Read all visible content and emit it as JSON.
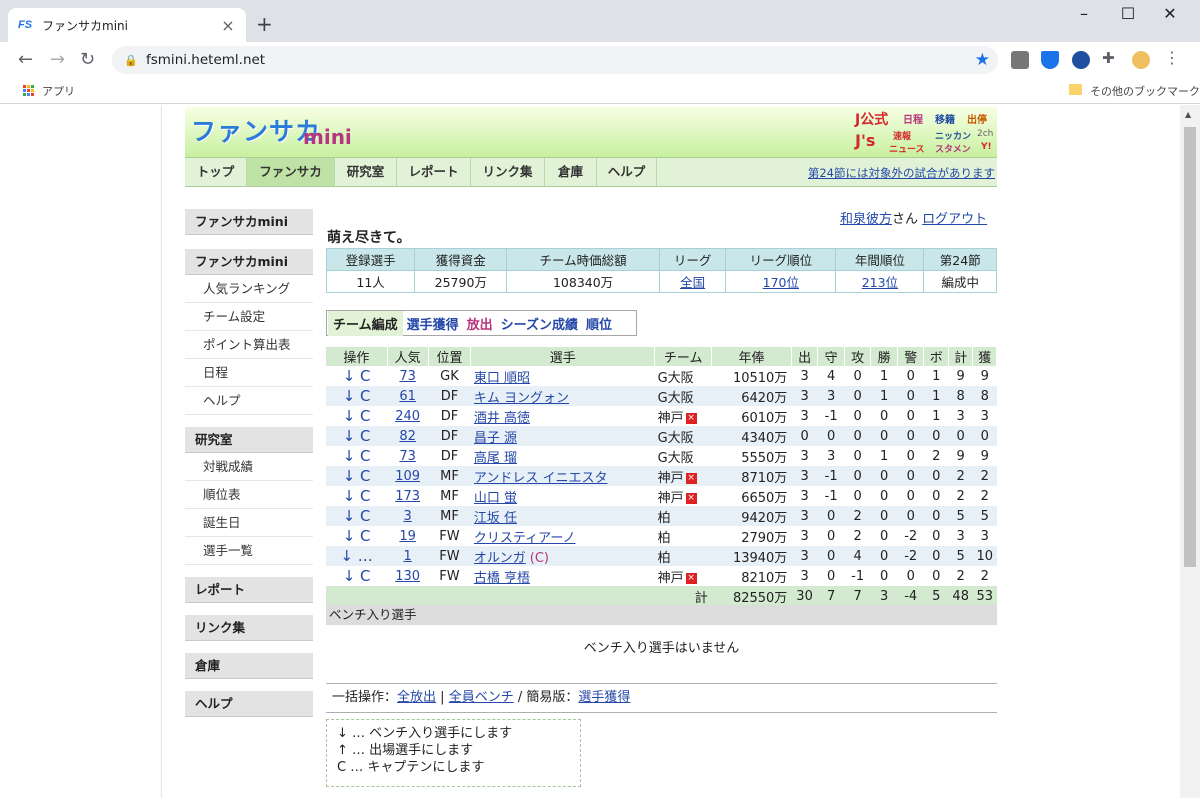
{
  "browser": {
    "tab_favicon": "FS",
    "tab_title": "ファンサカmini",
    "url": "fsmini.heteml.net",
    "bookmarks_apps": "アプリ",
    "bookmarks_other": "その他のブックマーク"
  },
  "header": {
    "logo": "ファンサカ",
    "logo_sub": "mini",
    "jlinks": [
      "J公式",
      "日程",
      "移籍",
      "出停",
      "J's",
      "速報",
      "ニッカン",
      "2ch",
      "ニュース",
      "スタメン",
      "Y!"
    ]
  },
  "nav": {
    "items": [
      "トップ",
      "ファンサカ",
      "研究室",
      "レポート",
      "リンク集",
      "倉庫",
      "ヘルプ"
    ],
    "active": "ファンサカ",
    "notice": "第24節には対象外の試合があります"
  },
  "sidebar": {
    "title": "ファンサカmini",
    "groups": [
      {
        "head": "ファンサカmini",
        "items": [
          "人気ランキング",
          "チーム設定",
          "ポイント算出表",
          "日程",
          "ヘルプ"
        ]
      },
      {
        "head": "研究室",
        "items": [
          "対戦成績",
          "順位表",
          "誕生日",
          "選手一覧"
        ]
      },
      {
        "head": "レポート",
        "items": []
      },
      {
        "head": "リンク集",
        "items": []
      },
      {
        "head": "倉庫",
        "items": []
      },
      {
        "head": "ヘルプ",
        "items": []
      }
    ]
  },
  "user": {
    "name": "和泉彼方",
    "suffix": "さん",
    "logout": "ログアウト"
  },
  "team": {
    "name": "萌え尽きて。",
    "summary_headers": [
      "登録選手",
      "獲得資金",
      "チーム時価総額",
      "リーグ",
      "リーグ順位",
      "年間順位",
      "第24節"
    ],
    "summary_values": [
      "11人",
      "25790万",
      "108340万",
      "全国",
      "170位",
      "213位",
      "編成中"
    ]
  },
  "subtabs": [
    "チーム編成",
    "選手獲得",
    "放出",
    "シーズン成績",
    "順位"
  ],
  "roster": {
    "headers": [
      "操作",
      "人気",
      "位置",
      "選手",
      "チーム",
      "年俸",
      "出",
      "守",
      "攻",
      "勝",
      "警",
      "ボ",
      "計",
      "獲"
    ],
    "rows": [
      {
        "op": "↓",
        "cap": "C",
        "pop": "73",
        "pos": "GK",
        "name": "東口 順昭",
        "team": "G大阪",
        "x": false,
        "price": "10510万",
        "s": [
          "3",
          "4",
          "0",
          "1",
          "0",
          "1",
          "9",
          "9"
        ]
      },
      {
        "op": "↓",
        "cap": "C",
        "pop": "61",
        "pos": "DF",
        "name": "キム ヨングォン",
        "team": "G大阪",
        "x": false,
        "price": "6420万",
        "s": [
          "3",
          "3",
          "0",
          "1",
          "0",
          "1",
          "8",
          "8"
        ]
      },
      {
        "op": "↓",
        "cap": "C",
        "pop": "240",
        "pos": "DF",
        "name": "酒井 高徳",
        "team": "神戸",
        "x": true,
        "price": "6010万",
        "s": [
          "3",
          "-1",
          "0",
          "0",
          "0",
          "1",
          "3",
          "3"
        ]
      },
      {
        "op": "↓",
        "cap": "C",
        "pop": "82",
        "pos": "DF",
        "name": "昌子 源",
        "team": "G大阪",
        "x": false,
        "price": "4340万",
        "s": [
          "0",
          "0",
          "0",
          "0",
          "0",
          "0",
          "0",
          "0"
        ]
      },
      {
        "op": "↓",
        "cap": "C",
        "pop": "73",
        "pos": "DF",
        "name": "高尾 瑠",
        "team": "G大阪",
        "x": false,
        "price": "5550万",
        "s": [
          "3",
          "3",
          "0",
          "1",
          "0",
          "2",
          "9",
          "9"
        ]
      },
      {
        "op": "↓",
        "cap": "C",
        "pop": "109",
        "pos": "MF",
        "name": "アンドレス イニエスタ",
        "team": "神戸",
        "x": true,
        "price": "8710万",
        "s": [
          "3",
          "-1",
          "0",
          "0",
          "0",
          "0",
          "2",
          "2"
        ]
      },
      {
        "op": "↓",
        "cap": "C",
        "pop": "173",
        "pos": "MF",
        "name": "山口 蛍",
        "team": "神戸",
        "x": true,
        "price": "6650万",
        "s": [
          "3",
          "-1",
          "0",
          "0",
          "0",
          "0",
          "2",
          "2"
        ]
      },
      {
        "op": "↓",
        "cap": "C",
        "pop": "3",
        "pos": "MF",
        "name": "江坂 任",
        "team": "柏",
        "x": false,
        "price": "9420万",
        "s": [
          "3",
          "0",
          "2",
          "0",
          "0",
          "0",
          "5",
          "5"
        ]
      },
      {
        "op": "↓",
        "cap": "C",
        "pop": "19",
        "pos": "FW",
        "name": "クリスティアーノ",
        "team": "柏",
        "x": false,
        "price": "2790万",
        "s": [
          "3",
          "0",
          "2",
          "0",
          "-2",
          "0",
          "3",
          "3"
        ]
      },
      {
        "op": "↓",
        "cap": "…",
        "pop": "1",
        "pos": "FW",
        "name": "オルンガ",
        "captain": "(C)",
        "team": "柏",
        "x": false,
        "price": "13940万",
        "s": [
          "3",
          "0",
          "4",
          "0",
          "-2",
          "0",
          "5",
          "10"
        ]
      },
      {
        "op": "↓",
        "cap": "C",
        "pop": "130",
        "pos": "FW",
        "name": "古橋 亨梧",
        "team": "神戸",
        "x": true,
        "price": "8210万",
        "s": [
          "3",
          "0",
          "-1",
          "0",
          "0",
          "0",
          "2",
          "2"
        ]
      }
    ],
    "total_label": "計",
    "total_price": "82550万",
    "totals": [
      "30",
      "7",
      "7",
      "3",
      "-4",
      "5",
      "48",
      "53"
    ]
  },
  "bench": {
    "head": "ベンチ入り選手",
    "empty": "ベンチ入り選手はいません"
  },
  "bulk": {
    "label": "一括操作：",
    "release_all": "全放出",
    "sep1": " | ",
    "bench_all": "全員ベンチ",
    "sep2": " / 簡易版：",
    "acquire": "選手獲得"
  },
  "legend": [
    "↓ … ベンチ入り選手にします",
    "↑ … 出場選手にします",
    "C … キャプテンにします"
  ]
}
